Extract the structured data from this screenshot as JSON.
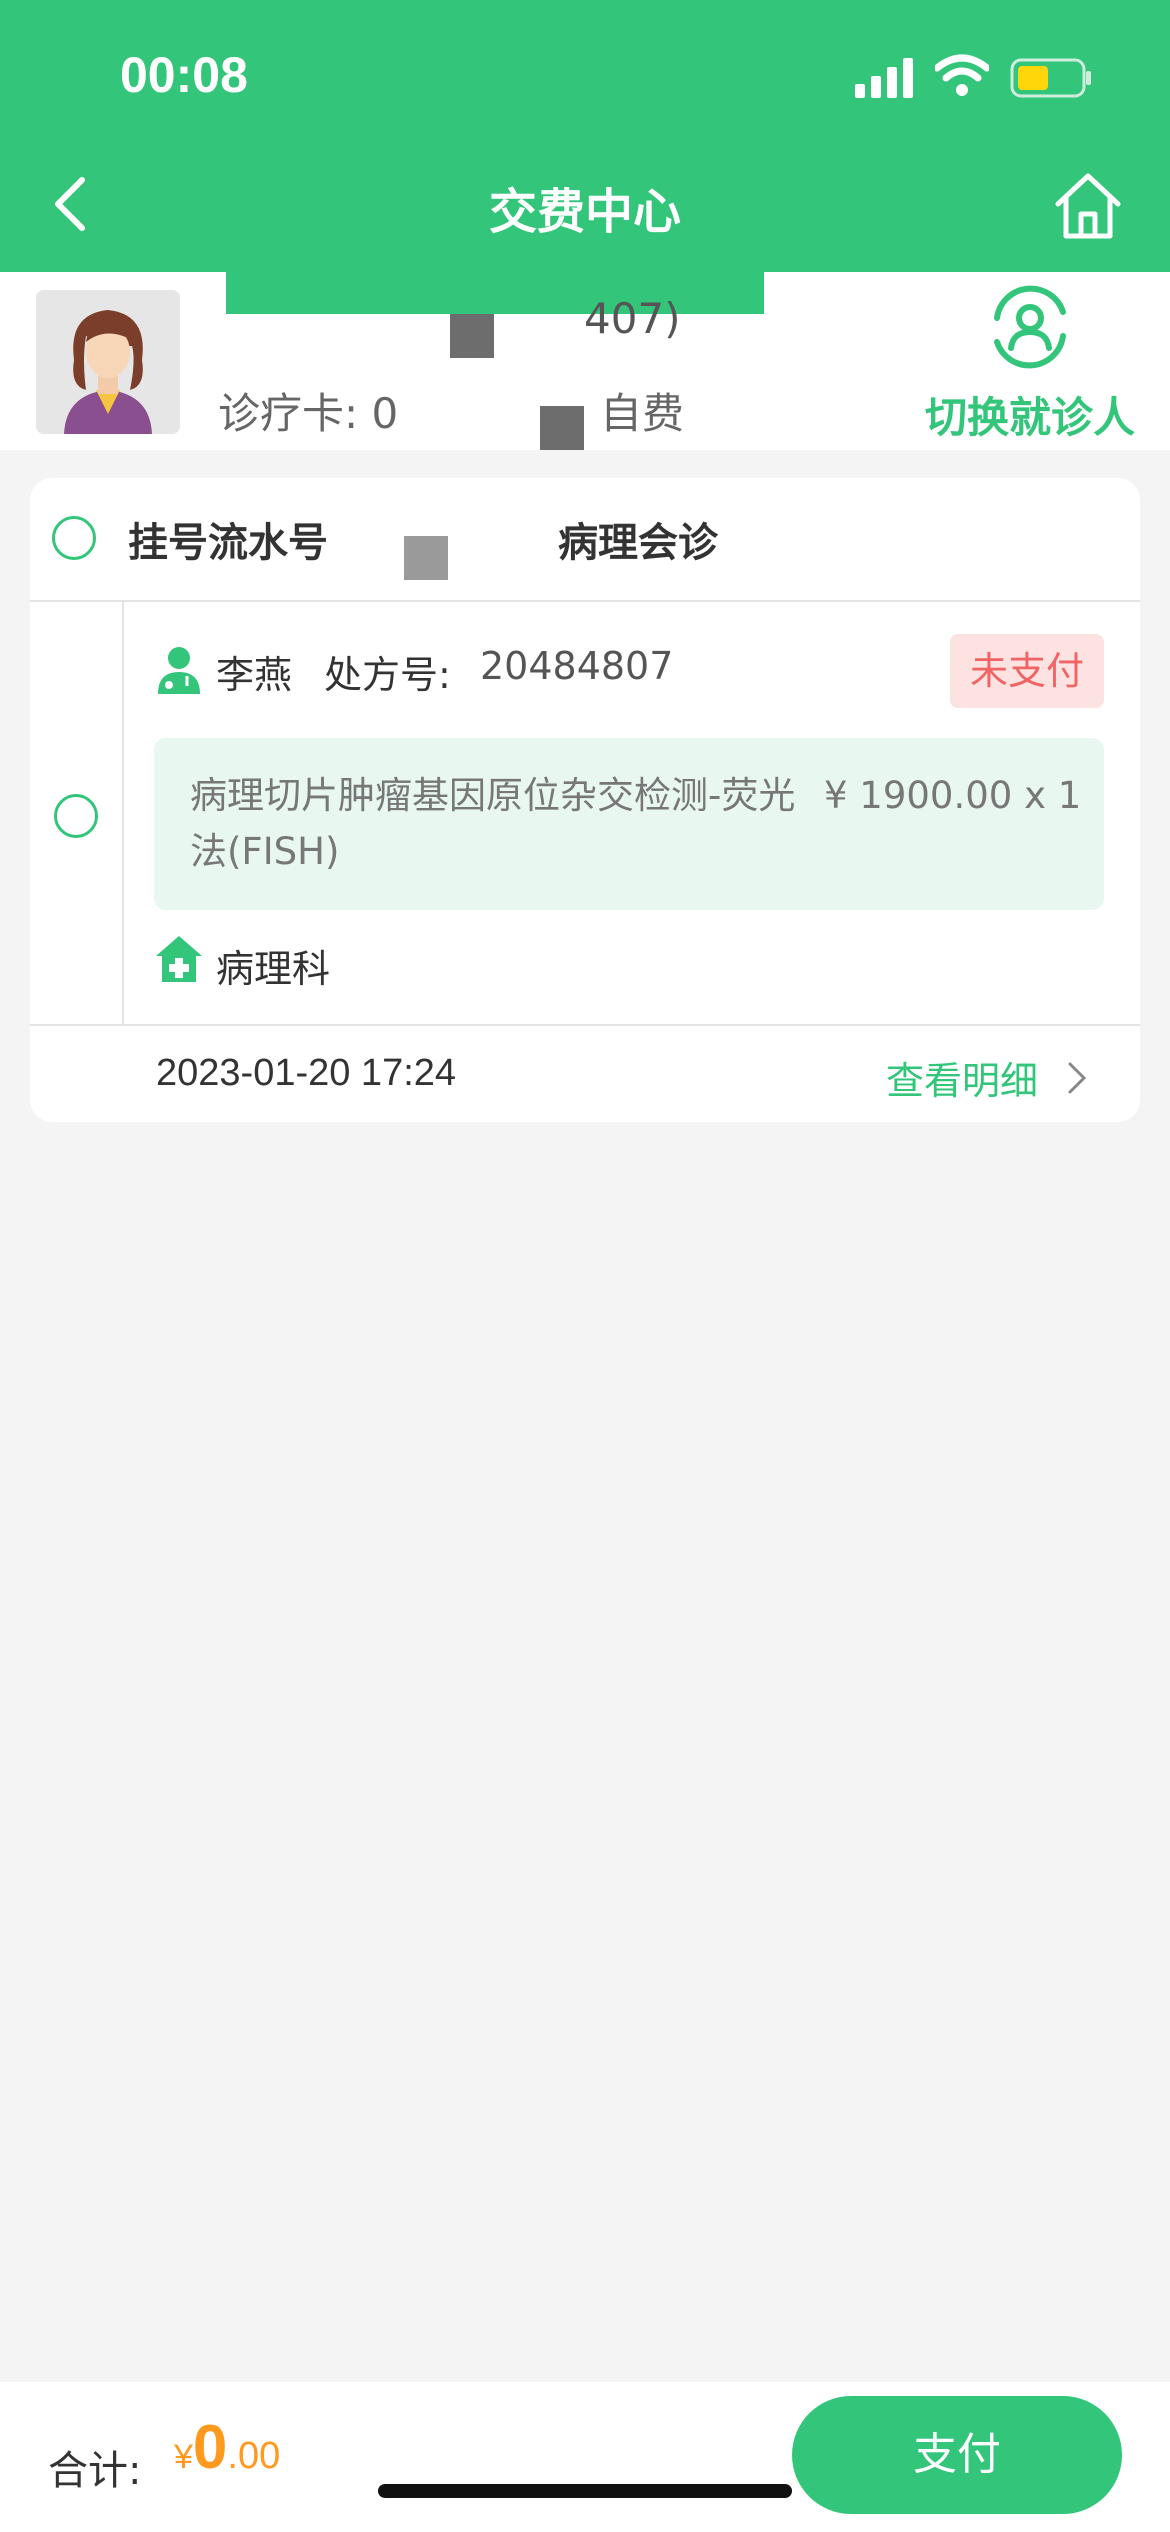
{
  "status_bar": {
    "time": "00:08"
  },
  "header": {
    "title": "交费中心"
  },
  "patient": {
    "name_partial": "",
    "id_partial": "407)",
    "card_label": "诊疗卡: 0",
    "pay_type": "自费",
    "switch_label": "切换就诊人"
  },
  "order": {
    "reg_label": "挂号流水号",
    "dept_title": "病理会诊",
    "doctor_name": "李燕",
    "rx_label": "处方号:",
    "rx_value": "20484807",
    "status_badge": "未支付",
    "item": {
      "name": "病理切片肿瘤基因原位杂交检测-荧光法(FISH)",
      "price": "¥ 1900.00 x 1"
    },
    "department": "病理科",
    "datetime": "2023-01-20 17:24",
    "detail_link": "查看明细"
  },
  "footer": {
    "total_label": "合计:",
    "currency": "¥",
    "total_int": "0",
    "total_dec": ".00",
    "pay_button": "支付"
  },
  "colors": {
    "accent": "#33c57a",
    "orange": "#ff9a1e",
    "badge_bg": "#fde2e2",
    "badge_text": "#f06464"
  },
  "icons": [
    "back-icon",
    "home-icon",
    "switch-user-icon",
    "doctor-icon",
    "hospital-icon",
    "chevron-right-icon"
  ]
}
